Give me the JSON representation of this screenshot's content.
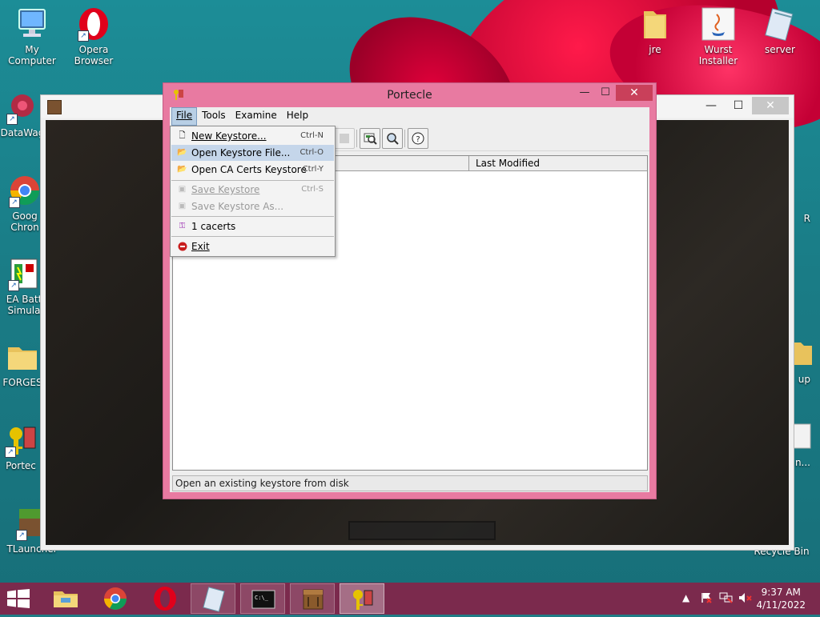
{
  "desktop": {
    "icons_left": [
      {
        "label": "My Computer"
      },
      {
        "label": "DataWag"
      },
      {
        "label": "Goog\nChron"
      },
      {
        "label": "EA Batt\nSimula"
      },
      {
        "label": "FORGES"
      },
      {
        "label": "Portec"
      },
      {
        "label": "TLauncher"
      }
    ],
    "icons_top": [
      {
        "label": "Opera\nBrowser"
      },
      {
        "label": "jre"
      },
      {
        "label": "Wurst\nInstaller"
      },
      {
        "label": "server"
      }
    ],
    "icons_right_partial": [
      {
        "label": "R"
      },
      {
        "label": "up"
      },
      {
        "label": "n..."
      },
      {
        "label": "Recycle Bin"
      }
    ]
  },
  "window": {
    "title": "Portecle",
    "controls": {
      "minimize": "—",
      "maximize": "☐",
      "close": "✕"
    },
    "menubar": [
      {
        "label": "File",
        "mnemonic": "F"
      },
      {
        "label": "Tools",
        "mnemonic": "T"
      },
      {
        "label": "Examine",
        "mnemonic": "E"
      },
      {
        "label": "Help",
        "mnemonic": "H"
      }
    ],
    "table_headers": [
      "Last Modified"
    ],
    "status": "Open an existing keystore from disk"
  },
  "file_menu": {
    "items": [
      {
        "label": "New Keystore...",
        "shortcut": "Ctrl-N",
        "enabled": true
      },
      {
        "label": "Open Keystore File...",
        "shortcut": "Ctrl-O",
        "enabled": true,
        "highlighted": true
      },
      {
        "label": "Open CA Certs Keystore",
        "shortcut": "Ctrl-Y",
        "enabled": true
      },
      {
        "label": "Save Keystore",
        "shortcut": "Ctrl-S",
        "enabled": false
      },
      {
        "label": "Save Keystore As...",
        "shortcut": "",
        "enabled": false
      },
      {
        "label": "1 cacerts",
        "shortcut": "",
        "enabled": true
      },
      {
        "label": "Exit",
        "shortcut": "",
        "enabled": true
      }
    ]
  },
  "taskbar": {
    "clock_time": "9:37 AM",
    "clock_date": "4/11/2022",
    "tray_arrow": "▲"
  },
  "colors": {
    "window_frame": "#e87aa1",
    "taskbar": "#7b2a4d",
    "menu_highlight": "#c5d6ea",
    "close_button": "#c9405a"
  }
}
